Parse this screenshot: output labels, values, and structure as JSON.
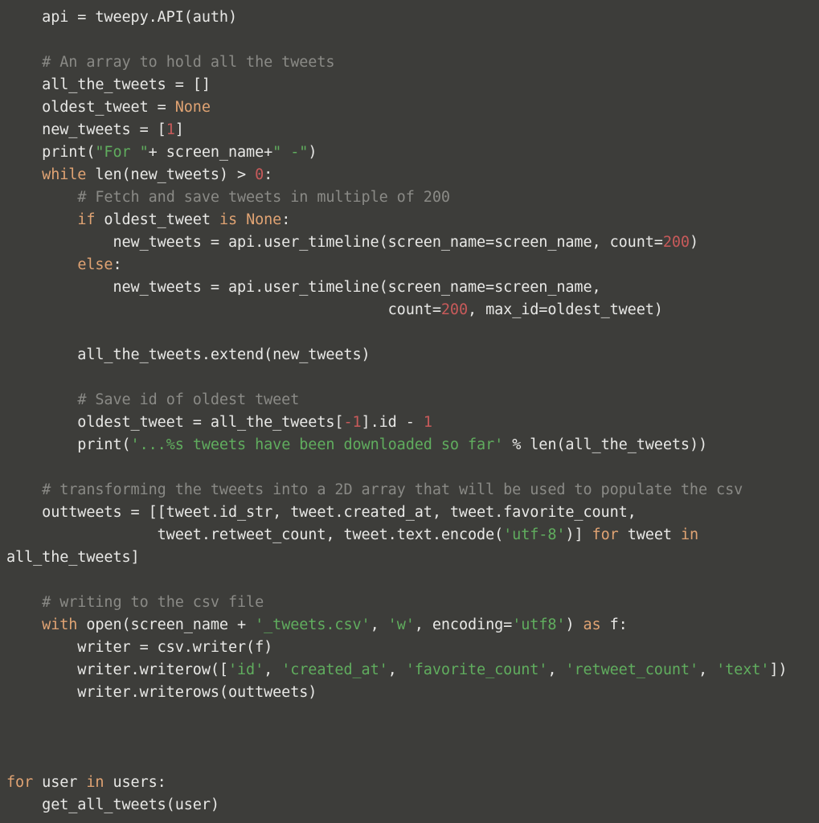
{
  "editor": {
    "language": "python",
    "background_color": "#3d3d3a",
    "colors": {
      "text": "#e8e8e6",
      "comment": "#8a8a86",
      "keyword": "#e0a373",
      "string": "#60ad5e",
      "number": "#c75a5a",
      "constant": "#e0a373"
    }
  },
  "lines": [
    {
      "index": 0,
      "text": "    api = tweepy.API(auth)",
      "tokens": [
        {
          "t": "    api = tweepy.API(auth)",
          "c": "plain"
        }
      ]
    },
    {
      "index": 1,
      "text": "",
      "tokens": []
    },
    {
      "index": 2,
      "text": "    # An array to hold all the tweets",
      "tokens": [
        {
          "t": "    ",
          "c": "plain"
        },
        {
          "t": "# An array to hold all the tweets",
          "c": "comment"
        }
      ]
    },
    {
      "index": 3,
      "text": "    all_the_tweets = []",
      "tokens": [
        {
          "t": "    all_the_tweets = []",
          "c": "plain"
        }
      ]
    },
    {
      "index": 4,
      "text": "    oldest_tweet = None",
      "tokens": [
        {
          "t": "    oldest_tweet = ",
          "c": "plain"
        },
        {
          "t": "None",
          "c": "const"
        }
      ]
    },
    {
      "index": 5,
      "text": "    new_tweets = [1]",
      "tokens": [
        {
          "t": "    new_tweets = [",
          "c": "plain"
        },
        {
          "t": "1",
          "c": "num"
        },
        {
          "t": "]",
          "c": "plain"
        }
      ]
    },
    {
      "index": 6,
      "text": "    print(\"For \"+ screen_name+\" -\")",
      "tokens": [
        {
          "t": "    print(",
          "c": "plain"
        },
        {
          "t": "\"For \"",
          "c": "str"
        },
        {
          "t": "+ screen_name+",
          "c": "plain"
        },
        {
          "t": "\" -\"",
          "c": "str"
        },
        {
          "t": ")",
          "c": "plain"
        }
      ]
    },
    {
      "index": 7,
      "text": "    while len(new_tweets) > 0:",
      "tokens": [
        {
          "t": "    ",
          "c": "plain"
        },
        {
          "t": "while",
          "c": "kw"
        },
        {
          "t": " len(new_tweets) > ",
          "c": "plain"
        },
        {
          "t": "0",
          "c": "num"
        },
        {
          "t": ":",
          "c": "plain"
        }
      ]
    },
    {
      "index": 8,
      "text": "        # Fetch and save tweets in multiple of 200",
      "tokens": [
        {
          "t": "        ",
          "c": "plain"
        },
        {
          "t": "# Fetch and save tweets in multiple of 200",
          "c": "comment"
        }
      ]
    },
    {
      "index": 9,
      "text": "        if oldest_tweet is None:",
      "tokens": [
        {
          "t": "        ",
          "c": "plain"
        },
        {
          "t": "if",
          "c": "kw"
        },
        {
          "t": " oldest_tweet ",
          "c": "plain"
        },
        {
          "t": "is",
          "c": "kw"
        },
        {
          "t": " ",
          "c": "plain"
        },
        {
          "t": "None",
          "c": "const"
        },
        {
          "t": ":",
          "c": "plain"
        }
      ]
    },
    {
      "index": 10,
      "text": "            new_tweets = api.user_timeline(screen_name=screen_name, count=200)",
      "tokens": [
        {
          "t": "            new_tweets = api.user_timeline(screen_name=screen_name, count=",
          "c": "plain"
        },
        {
          "t": "200",
          "c": "num"
        },
        {
          "t": ")",
          "c": "plain"
        }
      ]
    },
    {
      "index": 11,
      "text": "        else:",
      "tokens": [
        {
          "t": "        ",
          "c": "plain"
        },
        {
          "t": "else",
          "c": "kw"
        },
        {
          "t": ":",
          "c": "plain"
        }
      ]
    },
    {
      "index": 12,
      "text": "            new_tweets = api.user_timeline(screen_name=screen_name,",
      "tokens": [
        {
          "t": "            new_tweets = api.user_timeline(screen_name=screen_name,",
          "c": "plain"
        }
      ]
    },
    {
      "index": 13,
      "text": "                                           count=200, max_id=oldest_tweet)",
      "tokens": [
        {
          "t": "                                           count=",
          "c": "plain"
        },
        {
          "t": "200",
          "c": "num"
        },
        {
          "t": ", max_id=oldest_tweet)",
          "c": "plain"
        }
      ]
    },
    {
      "index": 14,
      "text": "",
      "tokens": []
    },
    {
      "index": 15,
      "text": "        all_the_tweets.extend(new_tweets)",
      "tokens": [
        {
          "t": "        all_the_tweets.extend(new_tweets)",
          "c": "plain"
        }
      ]
    },
    {
      "index": 16,
      "text": "",
      "tokens": []
    },
    {
      "index": 17,
      "text": "        # Save id of oldest tweet",
      "tokens": [
        {
          "t": "        ",
          "c": "plain"
        },
        {
          "t": "# Save id of oldest tweet",
          "c": "comment"
        }
      ]
    },
    {
      "index": 18,
      "text": "        oldest_tweet = all_the_tweets[-1].id - 1",
      "tokens": [
        {
          "t": "        oldest_tweet = all_the_tweets[",
          "c": "plain"
        },
        {
          "t": "-1",
          "c": "num"
        },
        {
          "t": "].id - ",
          "c": "plain"
        },
        {
          "t": "1",
          "c": "num"
        }
      ]
    },
    {
      "index": 19,
      "text": "        print('...%s tweets have been downloaded so far' % len(all_the_tweets))",
      "tokens": [
        {
          "t": "        print(",
          "c": "plain"
        },
        {
          "t": "'...%s tweets have been downloaded so far'",
          "c": "str"
        },
        {
          "t": " % len(all_the_tweets))",
          "c": "plain"
        }
      ]
    },
    {
      "index": 20,
      "text": "",
      "tokens": []
    },
    {
      "index": 21,
      "text": "    # transforming the tweets into a 2D array that will be used to populate the csv",
      "tokens": [
        {
          "t": "    ",
          "c": "plain"
        },
        {
          "t": "# transforming the tweets into a 2D array that will be used to populate the csv",
          "c": "comment"
        }
      ]
    },
    {
      "index": 22,
      "text": "    outtweets = [[tweet.id_str, tweet.created_at, tweet.favorite_count,",
      "tokens": [
        {
          "t": "    outtweets = [[tweet.id_str, tweet.created_at, tweet.favorite_count,",
          "c": "plain"
        }
      ]
    },
    {
      "index": 23,
      "text": "                 tweet.retweet_count, tweet.text.encode('utf-8')] for tweet in",
      "tokens": [
        {
          "t": "                 tweet.retweet_count, tweet.text.encode(",
          "c": "plain"
        },
        {
          "t": "'utf-8'",
          "c": "str"
        },
        {
          "t": ")] ",
          "c": "plain"
        },
        {
          "t": "for",
          "c": "kw"
        },
        {
          "t": " tweet ",
          "c": "plain"
        },
        {
          "t": "in",
          "c": "kw"
        }
      ]
    },
    {
      "index": 24,
      "text": "all_the_tweets]",
      "tokens": [
        {
          "t": "all_the_tweets]",
          "c": "plain"
        }
      ]
    },
    {
      "index": 25,
      "text": "",
      "tokens": []
    },
    {
      "index": 26,
      "text": "    # writing to the csv file",
      "tokens": [
        {
          "t": "    ",
          "c": "plain"
        },
        {
          "t": "# writing to the csv file",
          "c": "comment"
        }
      ]
    },
    {
      "index": 27,
      "text": "    with open(screen_name + '_tweets.csv', 'w', encoding='utf8') as f:",
      "tokens": [
        {
          "t": "    ",
          "c": "plain"
        },
        {
          "t": "with",
          "c": "kw"
        },
        {
          "t": " open(screen_name + ",
          "c": "plain"
        },
        {
          "t": "'_tweets.csv'",
          "c": "str"
        },
        {
          "t": ", ",
          "c": "plain"
        },
        {
          "t": "'w'",
          "c": "str"
        },
        {
          "t": ", encoding=",
          "c": "plain"
        },
        {
          "t": "'utf8'",
          "c": "str"
        },
        {
          "t": ") ",
          "c": "plain"
        },
        {
          "t": "as",
          "c": "kw"
        },
        {
          "t": " f:",
          "c": "plain"
        }
      ]
    },
    {
      "index": 28,
      "text": "        writer = csv.writer(f)",
      "tokens": [
        {
          "t": "        writer = csv.writer(f)",
          "c": "plain"
        }
      ]
    },
    {
      "index": 29,
      "text": "        writer.writerow(['id', 'created_at', 'favorite_count', 'retweet_count', 'text'])",
      "tokens": [
        {
          "t": "        writer.writerow([",
          "c": "plain"
        },
        {
          "t": "'id'",
          "c": "str"
        },
        {
          "t": ", ",
          "c": "plain"
        },
        {
          "t": "'created_at'",
          "c": "str"
        },
        {
          "t": ", ",
          "c": "plain"
        },
        {
          "t": "'favorite_count'",
          "c": "str"
        },
        {
          "t": ", ",
          "c": "plain"
        },
        {
          "t": "'retweet_count'",
          "c": "str"
        },
        {
          "t": ", ",
          "c": "plain"
        },
        {
          "t": "'text'",
          "c": "str"
        },
        {
          "t": "])",
          "c": "plain"
        }
      ]
    },
    {
      "index": 30,
      "text": "        writer.writerows(outtweets)",
      "tokens": [
        {
          "t": "        writer.writerows(outtweets)",
          "c": "plain"
        }
      ]
    },
    {
      "index": 31,
      "text": "",
      "tokens": []
    },
    {
      "index": 32,
      "text": "",
      "tokens": []
    },
    {
      "index": 33,
      "text": "",
      "tokens": []
    },
    {
      "index": 34,
      "text": "for user in users:",
      "tokens": [
        {
          "t": "for",
          "c": "kw"
        },
        {
          "t": " user ",
          "c": "plain"
        },
        {
          "t": "in",
          "c": "kw"
        },
        {
          "t": " users:",
          "c": "plain"
        }
      ]
    },
    {
      "index": 35,
      "text": "    get_all_tweets(user)",
      "tokens": [
        {
          "t": "    get_all_tweets(user)",
          "c": "plain"
        }
      ]
    }
  ]
}
